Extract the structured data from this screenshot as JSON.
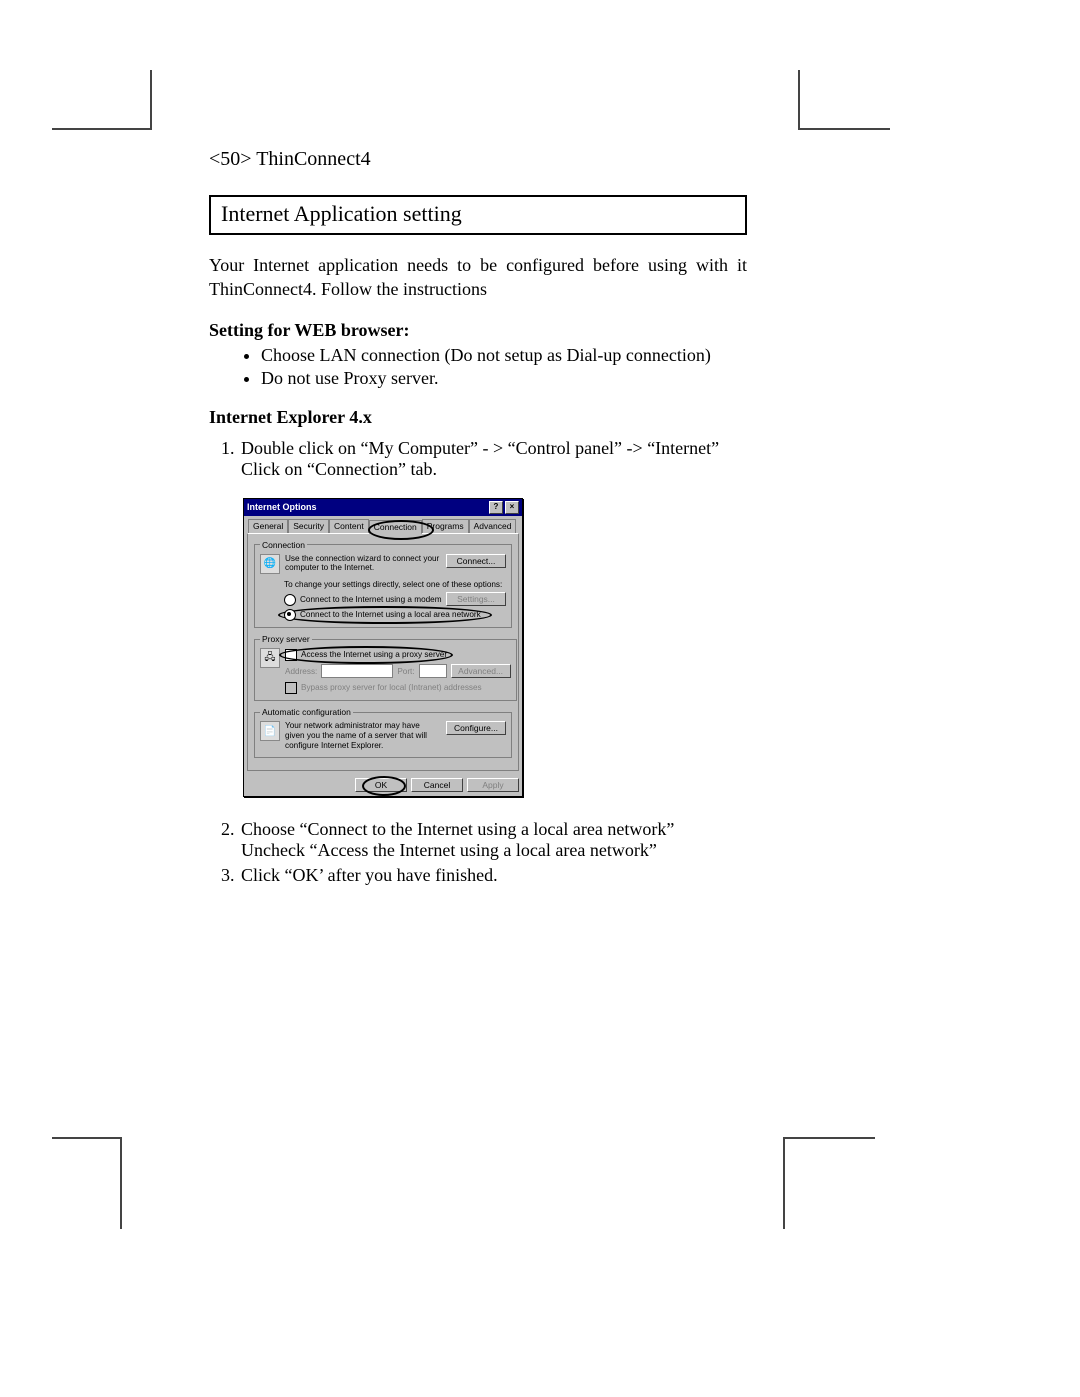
{
  "header": {
    "page_ref": "<50> ThinConnect4"
  },
  "section_title": "Internet Application setting",
  "intro": "Your Internet application needs to be configured before using with it ThinConnect4. Follow the instructions",
  "web_browser": {
    "heading": "Setting for WEB browser:",
    "bullets": [
      "Choose LAN connection (Do not setup as Dial-up connection)",
      "Do not use Proxy server."
    ]
  },
  "ie4": {
    "heading": "Internet Explorer 4.x",
    "step1a": "Double click on “My Computer” - > “Control panel” -> “Internet”",
    "step1b": "Click on “Connection” tab.",
    "step2a": "Choose “Connect to the Internet using  a local area network”",
    "step2b": "Uncheck “Access the Internet using a local area network”",
    "step3": "Click “OK’ after you have finished."
  },
  "dialog": {
    "title": "Internet Options",
    "window_buttons": {
      "help": "?",
      "close": "×"
    },
    "tabs": {
      "general": "General",
      "security": "Security",
      "content": "Content",
      "connection": "Connection",
      "programs": "Programs",
      "advanced": "Advanced"
    },
    "connection_group": {
      "legend": "Connection",
      "wizard_text": "Use the connection wizard to connect your computer to the Internet.",
      "connect_btn": "Connect...",
      "change_text": "To change your settings directly, select one of these options:",
      "radio_modem": "Connect to the Internet using a modem",
      "settings_btn": "Settings...",
      "radio_lan": "Connect to the Internet using a local area network"
    },
    "proxy_group": {
      "legend": "Proxy server",
      "access_checkbox": "Access the Internet using a proxy server",
      "address_label": "Address:",
      "port_label": "Port:",
      "advanced_btn": "Advanced...",
      "bypass_checkbox": "Bypass proxy server for local (Intranet) addresses"
    },
    "auto_group": {
      "legend": "Automatic configuration",
      "text": "Your network administrator may have given you the name of a server that will configure Internet Explorer.",
      "configure_btn": "Configure..."
    },
    "footer": {
      "ok": "OK",
      "cancel": "Cancel",
      "apply": "Apply"
    }
  }
}
